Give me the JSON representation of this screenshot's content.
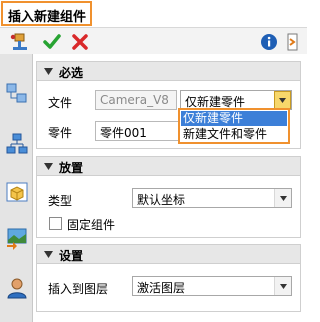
{
  "window": {
    "title": "插入新建组件"
  },
  "toolbar": {
    "ok_icon": "green-checkmark-icon",
    "cancel_icon": "red-x-icon",
    "info_icon": "info-icon",
    "pin_icon": "side-panel-pin-icon"
  },
  "rail": {
    "icons": [
      "insert-component-icon",
      "assembly-tree-icon",
      "hierarchy-icon",
      "part-box-icon",
      "image-import-icon",
      "user-icon"
    ]
  },
  "sections": {
    "required": {
      "title": "必选",
      "file_label": "文件",
      "file_value": "Camera_V8",
      "file_mode_value": "仅新建零件",
      "file_mode_options": [
        "仅新建零件",
        "新建文件和零件"
      ],
      "part_label": "零件",
      "part_value": "零件001"
    },
    "placement": {
      "title": "放置",
      "type_label": "类型",
      "type_value": "默认坐标",
      "fix_component_label": "固定组件",
      "fix_component_checked": false
    },
    "settings": {
      "title": "设置",
      "insert_layer_label": "插入到图层",
      "insert_layer_value": "激活图层"
    }
  }
}
